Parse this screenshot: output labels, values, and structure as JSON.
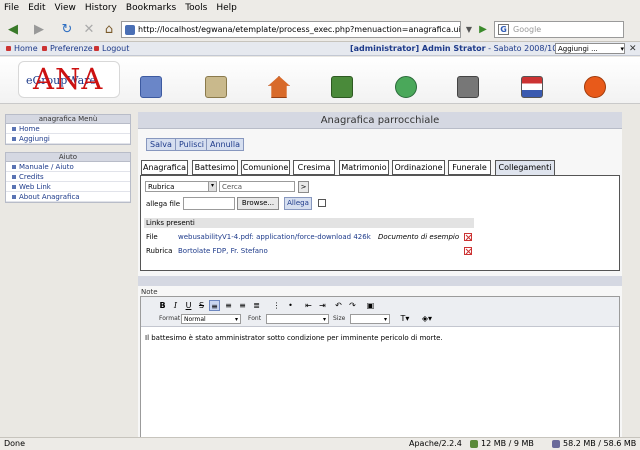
{
  "browser": {
    "menu": [
      "File",
      "Edit",
      "View",
      "History",
      "Bookmarks",
      "Tools",
      "Help"
    ],
    "url": "http://localhost/egwana/etemplate/process_exec.php?menuaction=anagrafica.uianagrafic",
    "search_placeholder": "Google",
    "status": {
      "left": "Done",
      "server": "Apache/2.2.4",
      "memory": "12 MB / 9 MB",
      "disk": "58.2 MB / 58.6 MB"
    }
  },
  "topbar": {
    "home": "Home",
    "preferences": "Preferenze",
    "logout": "Logout",
    "user": "[administrator] Admin Strator",
    "date": " - Sabato 2008/10/25",
    "add_select": "Aggiungi ..."
  },
  "logo": {
    "egw": "eGroupWare",
    "ana": "ANA"
  },
  "sidebar": {
    "menu_title": "anagrafica Menù",
    "menu_items": [
      "Home",
      "Aggiungi"
    ],
    "help_title": "Aiuto",
    "help_items": [
      "Manuale / Aiuto",
      "Credits",
      "Web Link",
      "About Anagrafica"
    ]
  },
  "panel": {
    "title": "Anagrafica parrocchiale",
    "buttons": {
      "save": "Salva",
      "clean": "Pulisci",
      "cancel": "Annulla"
    },
    "tabs": [
      "Anagrafica",
      "Battesimo",
      "Comunione",
      "Cresima",
      "Matrimonio",
      "Ordinazione",
      "Funerale",
      "Collegamenti"
    ],
    "links": {
      "app_select": "Rubrica",
      "search_value": "Cerca",
      "go": ">",
      "attach_label": "allega file",
      "browse": "Browse...",
      "attach_btn": "Allega",
      "present_header": "Links presenti",
      "rows": [
        {
          "type": "File",
          "text": "webusabilityV1-4.pdf: application/force-download 426k",
          "note": "Documento di esempio"
        },
        {
          "type": "Rubrica",
          "text": "Bortolate FDP, Fr. Stefano",
          "note": ""
        }
      ]
    },
    "notes": {
      "label": "Note",
      "format_label": "Format",
      "format_value": "Normal",
      "font_label": "Font",
      "size_label": "Size",
      "content": "Il battesimo è stato amministrator sotto condizione per imminente pericolo di morte."
    }
  }
}
